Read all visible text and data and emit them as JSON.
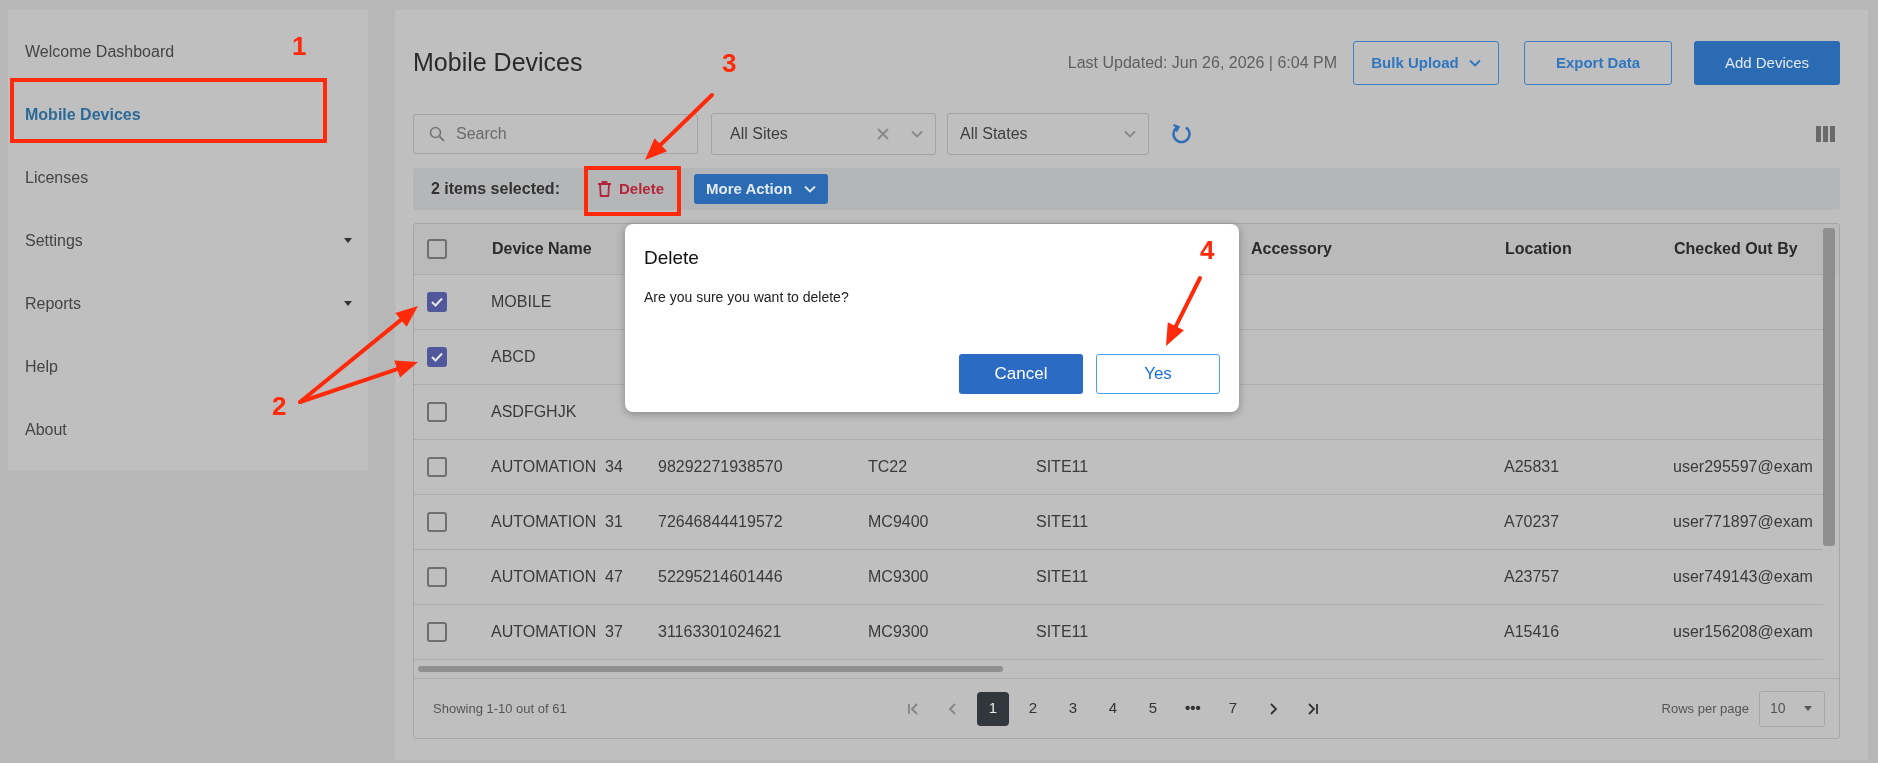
{
  "sidebar": {
    "items": [
      {
        "label": "Welcome Dashboard",
        "selected": false,
        "kind": "link"
      },
      {
        "label": "Mobile Devices",
        "selected": true,
        "kind": "link"
      },
      {
        "label": "Licenses",
        "selected": false,
        "kind": "link"
      },
      {
        "label": "Settings",
        "selected": false,
        "kind": "menu"
      },
      {
        "label": "Reports",
        "selected": false,
        "kind": "menu"
      },
      {
        "label": "Help",
        "selected": false,
        "kind": "link"
      },
      {
        "label": "About",
        "selected": false,
        "kind": "link"
      }
    ]
  },
  "header": {
    "title": "Mobile Devices",
    "last_updated": "Last Updated: Jun 26, 2026 | 6:04 PM",
    "buttons": [
      {
        "label": "Bulk Upload",
        "kind": "dropdown"
      },
      {
        "label": "Export Data",
        "kind": "outline"
      },
      {
        "label": "Add Devices",
        "kind": "primary"
      }
    ]
  },
  "filters": {
    "search": {
      "placeholder": "Search"
    },
    "site": {
      "value": "All Sites"
    },
    "state": {
      "value": "All States"
    }
  },
  "selection_bar": {
    "count": "2 items selected:",
    "delete": "Delete",
    "more": "More Action"
  },
  "table": {
    "header_checked": false,
    "columns": [
      "Device Name",
      null,
      null,
      null,
      "Accessory",
      "Location",
      "Checked Out By"
    ],
    "rows": [
      {
        "checked": true,
        "cells": [
          "MOBILE",
          null,
          null,
          null,
          null,
          null,
          null
        ]
      },
      {
        "checked": true,
        "cells": [
          "ABCD",
          null,
          null,
          null,
          null,
          null,
          null
        ]
      },
      {
        "checked": false,
        "cells": [
          "ASDFGHJK",
          null,
          null,
          null,
          null,
          null,
          null
        ]
      },
      {
        "checked": false,
        "cells": [
          "AUTOMATION  34",
          "98292271938570",
          "TC22",
          "SITE11",
          null,
          "A25831",
          "user295597@exam"
        ]
      },
      {
        "checked": false,
        "cells": [
          "AUTOMATION  31",
          "72646844419572",
          "MC9400",
          "SITE11",
          null,
          "A70237",
          "user771897@exam"
        ]
      },
      {
        "checked": false,
        "cells": [
          "AUTOMATION  47",
          "52295214601446",
          "MC9300",
          "SITE11",
          null,
          "A23757",
          "user749143@exam"
        ]
      },
      {
        "checked": false,
        "cells": [
          "AUTOMATION  37",
          "31163301024621",
          "MC9300",
          "SITE11",
          null,
          "A15416",
          "user156208@exam"
        ]
      }
    ]
  },
  "footer": {
    "showing": "Showing 1-10 out of 61",
    "pages": [
      {
        "label": "1",
        "selected": true
      },
      {
        "label": "2",
        "selected": false
      },
      {
        "label": "3",
        "selected": false
      },
      {
        "label": "4",
        "selected": false
      },
      {
        "label": "5",
        "selected": false
      },
      {
        "label": "•••",
        "selected": false
      },
      {
        "label": "7",
        "selected": false
      }
    ],
    "rows_per_page_label": "Rows per page",
    "rows_per_page": "10"
  },
  "dialog": {
    "title": "Delete",
    "message": "Are you sure you want to delete?",
    "buttons": [
      {
        "label": "Cancel",
        "kind": "primary"
      },
      {
        "label": "Yes",
        "kind": "outline"
      }
    ]
  },
  "annotations": [
    {
      "label": "1"
    },
    {
      "label": "2"
    },
    {
      "label": "3"
    },
    {
      "label": "4"
    }
  ]
}
